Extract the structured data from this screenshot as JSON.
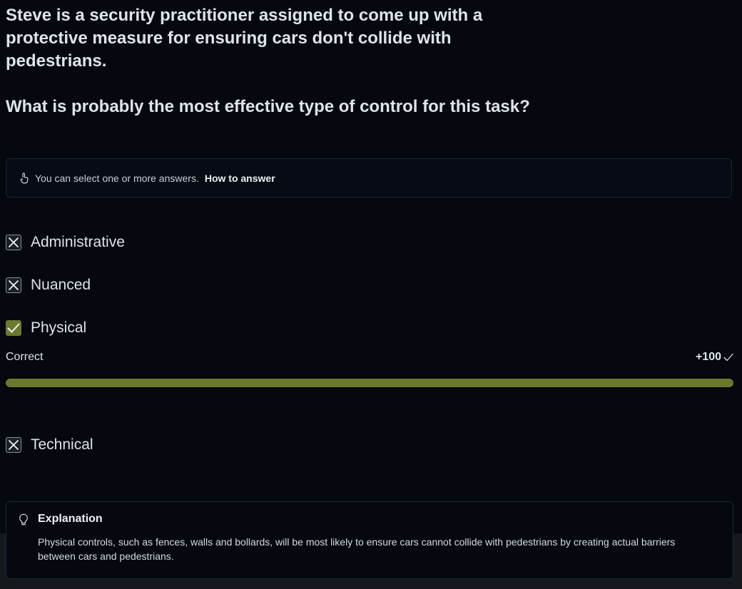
{
  "question": {
    "line1": "Steve is a security practitioner assigned to come up with a protective measure for ensuring cars don't collide with pedestrians.",
    "line2": "What is probably the most effective type of control for this task?"
  },
  "hint": {
    "icon": "hand-pointer-icon",
    "text": "You can select one or more answers.",
    "link": "How to answer"
  },
  "options": [
    {
      "label": "Administrative",
      "state": "incorrect",
      "icon": "x-icon"
    },
    {
      "label": "Nuanced",
      "state": "incorrect",
      "icon": "x-icon"
    },
    {
      "label": "Physical",
      "state": "correct",
      "icon": "check-icon"
    },
    {
      "label": "Technical",
      "state": "incorrect",
      "icon": "x-icon"
    }
  ],
  "result": {
    "status": "Correct",
    "score": "+100",
    "progress_percent": 100,
    "accent_color": "#6a7a2c"
  },
  "explanation": {
    "icon": "lightbulb-icon",
    "title": "Explanation",
    "body": "Physical controls, such as fences, walls and bollards, will be most likely to ensure cars cannot collide with pedestrians by creating actual barriers between cars and pedestrians."
  }
}
